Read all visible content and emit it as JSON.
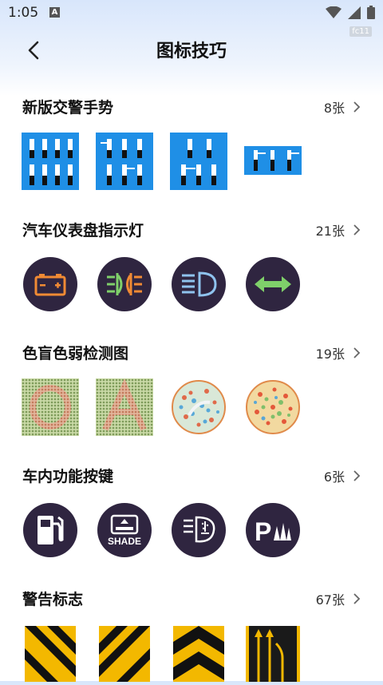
{
  "status": {
    "time": "1:05",
    "notif_letter": "A",
    "tag": "fc11"
  },
  "header": {
    "title": "图标技巧"
  },
  "sections": [
    {
      "title": "新版交警手势",
      "count": "8张"
    },
    {
      "title": "汽车仪表盘指示灯",
      "count": "21张"
    },
    {
      "title": "色盲色弱检测图",
      "count": "19张"
    },
    {
      "title": "车内功能按键",
      "count": "6张"
    },
    {
      "title": "警告标志",
      "count": "67张"
    }
  ],
  "icons": {
    "section1": [
      "traffic-police-gesture-icon",
      "traffic-police-gesture-icon",
      "traffic-police-gesture-icon",
      "traffic-police-gesture-icon"
    ],
    "section2": [
      "battery-warning-icon",
      "fog-light-icon",
      "high-beam-icon",
      "turn-signal-icon"
    ],
    "section3": [
      "color-blind-test-icon",
      "color-blind-test-icon",
      "color-blind-test-icon",
      "color-blind-test-icon"
    ],
    "section4": [
      "fuel-icon",
      "sunshade-icon",
      "wiper-icon",
      "parking-sensor-icon"
    ],
    "section5": [
      "hazard-stripe-sign-icon",
      "hazard-stripe-sign-icon",
      "chevron-sign-icon",
      "lane-merge-sign-icon"
    ]
  },
  "shade_text": "SHADE",
  "parking_text": "P",
  "colors": {
    "accent_blue": "#1f8fe6",
    "circle_bg": "#2f2540",
    "orange": "#f08a34",
    "green": "#7fd06a",
    "blue_light": "#8fc3ee",
    "sign_yellow": "#f3b800"
  }
}
